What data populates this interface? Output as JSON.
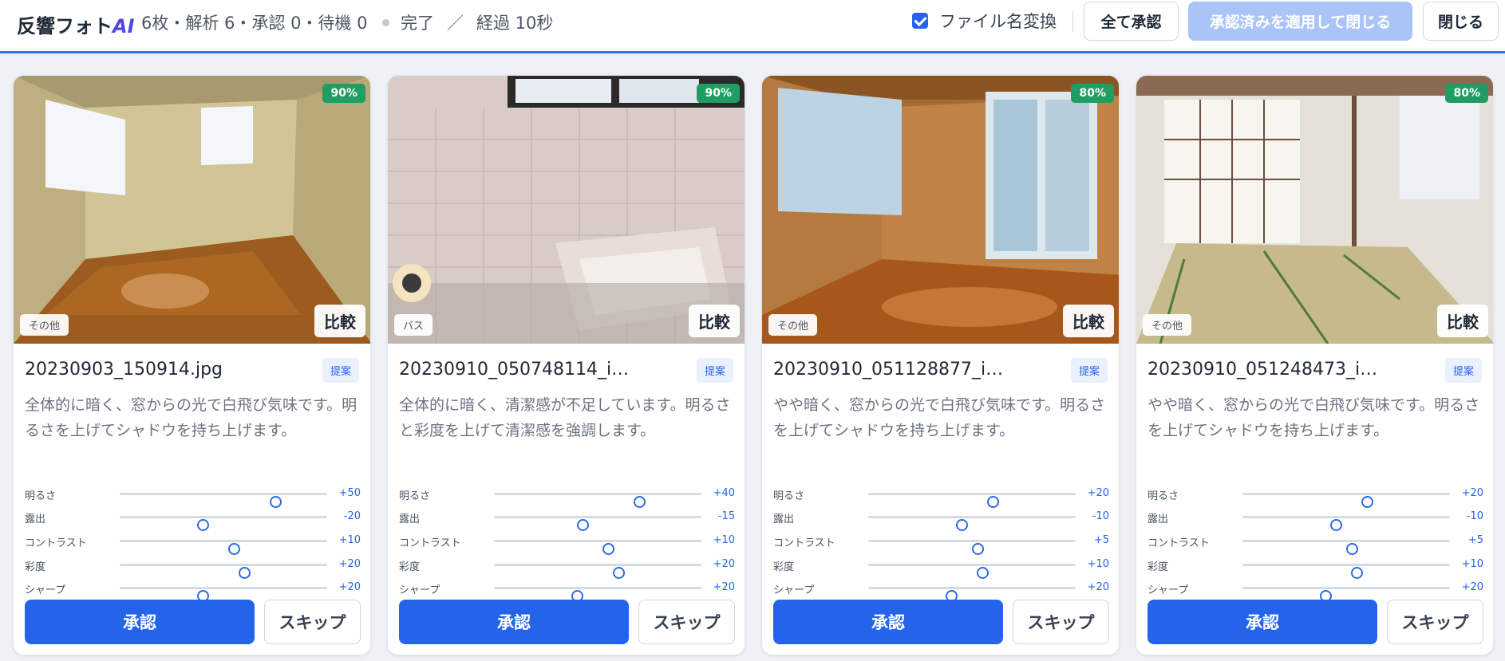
{
  "header": {
    "brand_main": "反響フォト",
    "brand_ai": "AI",
    "stats": "6枚・解析 6・承認 0・待機 0",
    "status_done": "完了",
    "status_sep": "／",
    "status_elapsed": "経過 10秒",
    "rename_label": "ファイル名変換",
    "rename_checked": true,
    "approve_all_label": "全て承認",
    "apply_close_label": "承認済みを適用して閉じる",
    "close_label": "閉じる"
  },
  "colors": {
    "accent": "#2563eb",
    "confidence_badge": "#1f9d62",
    "apply_disabled": "#a9c4f7"
  },
  "slider_range": {
    "min": -100,
    "max": 100
  },
  "cards": [
    {
      "confidence": "90%",
      "category": "その他",
      "compare_label": "比較",
      "filename": "20230903_150914.jpg",
      "tag": "提案",
      "description": "全体的に暗く、窓からの光で白飛び気味です。明るさを上げてシャドウを持ち上げます。",
      "sliders": [
        {
          "label": "明るさ",
          "value": 50,
          "display": "+50"
        },
        {
          "label": "露出",
          "value": -20,
          "display": "-20"
        },
        {
          "label": "コントラスト",
          "value": 10,
          "display": "+10"
        },
        {
          "label": "彩度",
          "value": 20,
          "display": "+20"
        },
        {
          "label": "シャープ",
          "value": -20,
          "display": "+20"
        }
      ],
      "approve_label": "承認",
      "skip_label": "スキップ"
    },
    {
      "confidence": "90%",
      "category": "バス",
      "compare_label": "比較",
      "filename": "20230910_050748114_i…",
      "tag": "提案",
      "description": "全体的に暗く、清潔感が不足しています。明るさと彩度を上げて清潔感を強調します。",
      "sliders": [
        {
          "label": "明るさ",
          "value": 40,
          "display": "+40"
        },
        {
          "label": "露出",
          "value": -15,
          "display": "-15"
        },
        {
          "label": "コントラスト",
          "value": 10,
          "display": "+10"
        },
        {
          "label": "彩度",
          "value": 20,
          "display": "+20"
        },
        {
          "label": "シャープ",
          "value": -20,
          "display": "+20"
        }
      ],
      "approve_label": "承認",
      "skip_label": "スキップ"
    },
    {
      "confidence": "80%",
      "category": "その他",
      "compare_label": "比較",
      "filename": "20230910_051128877_i…",
      "tag": "提案",
      "description": "やや暗く、窓からの光で白飛び気味です。明るさを上げてシャドウを持ち上げます。",
      "sliders": [
        {
          "label": "明るさ",
          "value": 20,
          "display": "+20"
        },
        {
          "label": "露出",
          "value": -10,
          "display": "-10"
        },
        {
          "label": "コントラスト",
          "value": 5,
          "display": "+5"
        },
        {
          "label": "彩度",
          "value": 10,
          "display": "+10"
        },
        {
          "label": "シャープ",
          "value": -20,
          "display": "+20"
        }
      ],
      "approve_label": "承認",
      "skip_label": "スキップ"
    },
    {
      "confidence": "80%",
      "category": "その他",
      "compare_label": "比較",
      "filename": "20230910_051248473_i…",
      "tag": "提案",
      "description": "やや暗く、窓からの光で白飛び気味です。明るさを上げてシャドウを持ち上げます。",
      "sliders": [
        {
          "label": "明るさ",
          "value": 20,
          "display": "+20"
        },
        {
          "label": "露出",
          "value": -10,
          "display": "-10"
        },
        {
          "label": "コントラスト",
          "value": 5,
          "display": "+5"
        },
        {
          "label": "彩度",
          "value": 10,
          "display": "+10"
        },
        {
          "label": "シャープ",
          "value": -20,
          "display": "+20"
        }
      ],
      "approve_label": "承認",
      "skip_label": "スキップ"
    }
  ]
}
